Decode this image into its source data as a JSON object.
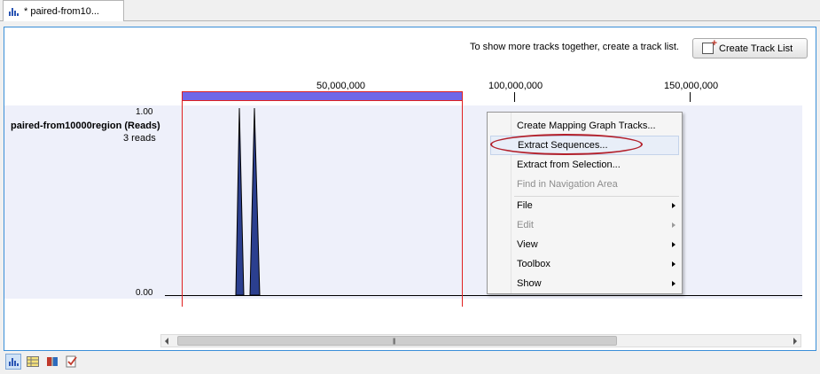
{
  "tab": {
    "title": "* paired-from10...",
    "icon": "bar-chart-icon"
  },
  "header": {
    "hint": "To show more tracks together, create a track list.",
    "create_button": "Create Track List",
    "create_icon": "create-track-list-icon"
  },
  "ruler": {
    "ticks": [
      "50,000,000",
      "100,000,000",
      "150,000,000"
    ]
  },
  "track": {
    "name": "paired-from10000region (Reads)",
    "reads": "3 reads",
    "y_max": "1.00",
    "y_min": "0.00"
  },
  "context_menu": {
    "items": [
      {
        "label": "Create Mapping Graph Tracks...",
        "enabled": true,
        "submenu": false
      },
      {
        "label": "Extract Sequences...",
        "enabled": true,
        "submenu": false,
        "highlighted": true
      },
      {
        "label": "Extract from Selection...",
        "enabled": true,
        "submenu": false
      },
      {
        "label": "Find in Navigation Area",
        "enabled": false,
        "submenu": false
      },
      {
        "label": "File",
        "enabled": true,
        "submenu": true
      },
      {
        "label": "Edit",
        "enabled": false,
        "submenu": true
      },
      {
        "label": "View",
        "enabled": true,
        "submenu": true
      },
      {
        "label": "Toolbox",
        "enabled": true,
        "submenu": true
      },
      {
        "label": "Show",
        "enabled": true,
        "submenu": true
      }
    ]
  },
  "bottom_toolbar": {
    "buttons": [
      "track-view-icon",
      "table-view-icon",
      "book-icon",
      "history-icon"
    ]
  },
  "colors": {
    "selection_bar": "#7067e8",
    "selection_border": "#e02020",
    "peak_fill": "#2b3f8f",
    "track_background": "#eef0fa",
    "highlight_oval": "#b3202b",
    "editor_border": "#3a8fd8"
  }
}
